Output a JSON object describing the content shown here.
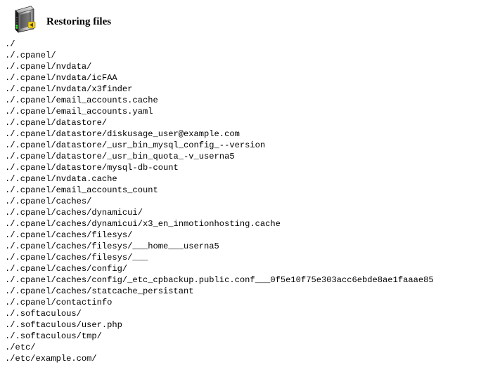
{
  "header": {
    "icon": "server-icon",
    "title": "Restoring files"
  },
  "files": [
    "./",
    "./.cpanel/",
    "./.cpanel/nvdata/",
    "./.cpanel/nvdata/icFAA",
    "./.cpanel/nvdata/x3finder",
    "./.cpanel/email_accounts.cache",
    "./.cpanel/email_accounts.yaml",
    "./.cpanel/datastore/",
    "./.cpanel/datastore/diskusage_user@example.com",
    "./.cpanel/datastore/_usr_bin_mysql_config_--version",
    "./.cpanel/datastore/_usr_bin_quota_-v_userna5",
    "./.cpanel/datastore/mysql-db-count",
    "./.cpanel/nvdata.cache",
    "./.cpanel/email_accounts_count",
    "./.cpanel/caches/",
    "./.cpanel/caches/dynamicui/",
    "./.cpanel/caches/dynamicui/x3_en_inmotionhosting.cache",
    "./.cpanel/caches/filesys/",
    "./.cpanel/caches/filesys/___home___userna5",
    "./.cpanel/caches/filesys/___",
    "./.cpanel/caches/config/",
    "./.cpanel/caches/config/_etc_cpbackup.public.conf___0f5e10f75e303acc6ebde8ae1faaae85",
    "./.cpanel/caches/statcache_persistant",
    "./.cpanel/contactinfo",
    "./.softaculous/",
    "./.softaculous/user.php",
    "./.softaculous/tmp/",
    "./etc/",
    "./etc/example.com/"
  ]
}
